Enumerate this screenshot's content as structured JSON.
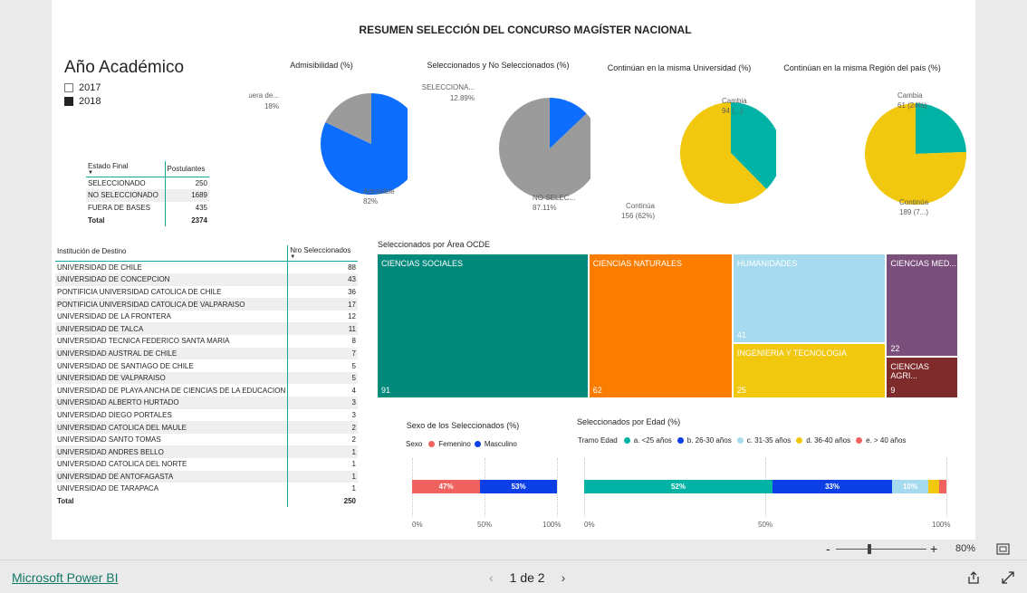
{
  "report": {
    "title": "RESUMEN SELECCIÓN DEL CONCURSO MAGÍSTER NACIONAL"
  },
  "slicer": {
    "title": "Año Académico",
    "options": [
      {
        "label": "2017",
        "checked": false
      },
      {
        "label": "2018",
        "checked": true
      }
    ]
  },
  "estado_table": {
    "headers": [
      "Estado Final",
      "Postulantes"
    ],
    "rows": [
      [
        "SELECCIONADO",
        "250"
      ],
      [
        "NO SELECCIONADO",
        "1689"
      ],
      [
        "FUERA DE BASES",
        "435"
      ]
    ],
    "total": [
      "Total",
      "2374"
    ]
  },
  "inst_table": {
    "headers": [
      "Institución de Destino",
      "Nro Seleccionados"
    ],
    "rows": [
      [
        "UNIVERSIDAD DE CHILE",
        "88"
      ],
      [
        "UNIVERSIDAD DE CONCEPCION",
        "43"
      ],
      [
        "PONTIFICIA UNIVERSIDAD CATOLICA DE CHILE",
        "36"
      ],
      [
        "PONTIFICIA UNIVERSIDAD CATOLICA DE VALPARAISO",
        "17"
      ],
      [
        "UNIVERSIDAD DE LA FRONTERA",
        "12"
      ],
      [
        "UNIVERSIDAD DE TALCA",
        "11"
      ],
      [
        "UNIVERSIDAD TECNICA FEDERICO SANTA MARIA",
        "8"
      ],
      [
        "UNIVERSIDAD AUSTRAL DE CHILE",
        "7"
      ],
      [
        "UNIVERSIDAD DE SANTIAGO DE CHILE",
        "5"
      ],
      [
        "UNIVERSIDAD DE VALPARAISO",
        "5"
      ],
      [
        "UNIVERSIDAD DE PLAYA ANCHA DE CIENCIAS DE LA EDUCACION",
        "4"
      ],
      [
        "UNIVERSIDAD ALBERTO HURTADO",
        "3"
      ],
      [
        "UNIVERSIDAD DIEGO PORTALES",
        "3"
      ],
      [
        "UNIVERSIDAD CATOLICA DEL MAULE",
        "2"
      ],
      [
        "UNIVERSIDAD SANTO TOMAS",
        "2"
      ],
      [
        "UNIVERSIDAD ANDRES BELLO",
        "1"
      ],
      [
        "UNIVERSIDAD CATOLICA DEL NORTE",
        "1"
      ],
      [
        "UNIVERSIDAD DE ANTOFAGASTA",
        "1"
      ],
      [
        "UNIVERSIDAD DE TARAPACA",
        "1"
      ]
    ],
    "total": [
      "Total",
      "250"
    ]
  },
  "chart_data": [
    {
      "id": "pie1",
      "type": "pie",
      "title": "Admisibilidad (%)",
      "slices": [
        {
          "label": "Admisible",
          "value": 82,
          "label_text": "Admisible",
          "value_text": "82%",
          "color": "#0d6efd"
        },
        {
          "label": "Fuera de...",
          "value": 18,
          "label_text": "Fuera de...",
          "value_text": "18%",
          "color": "#9b9b9b"
        }
      ]
    },
    {
      "id": "pie2",
      "type": "pie",
      "title": "Seleccionados y No Seleccionados (%)",
      "slices": [
        {
          "label": "NO SELEC...",
          "value": 87.11,
          "label_text": "NO SELEC...",
          "value_text": "87.11%",
          "color": "#9b9b9b"
        },
        {
          "label": "SELECCIONA...",
          "value": 12.89,
          "label_text": "SELECCIONA...",
          "value_text": "12.89%",
          "color": "#0d6efd"
        }
      ]
    },
    {
      "id": "pie3",
      "type": "pie",
      "title": "Continúan en la misma Universidad (%)",
      "slices": [
        {
          "label": "Cambia",
          "value": 94,
          "label_text": "Cambia",
          "value_text": "94 (...)",
          "color": "#00b3a4"
        },
        {
          "label": "Continúa",
          "value": 156,
          "label_text": "Continúa",
          "value_text": "156 (62%)",
          "color": "#f2c80f"
        }
      ]
    },
    {
      "id": "pie4",
      "type": "pie",
      "title": "Continúan en la misma Región del país (%)",
      "slices": [
        {
          "label": "Cambia",
          "value": 61,
          "label_text": "Cambia",
          "value_text": "61 (24%)",
          "color": "#00b3a4"
        },
        {
          "label": "Continúa",
          "value": 189,
          "label_text": "Continúa",
          "value_text": "189 (7...)",
          "color": "#f2c80f"
        }
      ]
    },
    {
      "id": "treemap",
      "type": "treemap",
      "title": "Seleccionados por Área OCDE",
      "items": [
        {
          "label": "CIENCIAS SOCIALES",
          "value": 91,
          "color": "#01897b"
        },
        {
          "label": "CIENCIAS NATURALES",
          "value": 62,
          "color": "#fb7d00"
        },
        {
          "label": "HUMANIDADES",
          "value": 41,
          "color": "#a6dbef"
        },
        {
          "label": "INGENIERIA Y TECNOLOGIA",
          "value": 25,
          "color": "#f2c80f"
        },
        {
          "label": "CIENCIAS MED...",
          "value": 22,
          "color": "#7a4f7c"
        },
        {
          "label": "CIENCIAS AGRI...",
          "value": 9,
          "color": "#7f2b2b"
        }
      ]
    },
    {
      "id": "sexo",
      "type": "bar",
      "stacked": "100%",
      "title": "Sexo de los Seleccionados (%)",
      "legend_title": "Sexo",
      "series": [
        {
          "name": "Femenino",
          "value": 47,
          "label": "47%",
          "color": "#f0625f"
        },
        {
          "name": "Masculino",
          "value": 53,
          "label": "53%",
          "color": "#0d3fe6"
        }
      ],
      "ticks": [
        "0%",
        "50%",
        "100%"
      ]
    },
    {
      "id": "edad",
      "type": "bar",
      "stacked": "100%",
      "title": "Seleccionados por Edad (%)",
      "legend_title": "Tramo Edad",
      "series": [
        {
          "name": "a. <25 años",
          "value": 52,
          "label": "52%",
          "color": "#00b3a4"
        },
        {
          "name": "b. 26-30 años",
          "value": 33,
          "label": "33%",
          "color": "#0d3fe6"
        },
        {
          "name": "c. 31-35 años",
          "value": 10,
          "label": "10%",
          "color": "#a6dbef"
        },
        {
          "name": "d. 36-40 años",
          "value": 3,
          "label": "",
          "color": "#f2c80f"
        },
        {
          "name": "e. > 40 años",
          "value": 2,
          "label": "",
          "color": "#f0625f"
        }
      ],
      "ticks": [
        "0%",
        "50%",
        "100%"
      ]
    }
  ],
  "footer": {
    "brand": "Microsoft Power BI",
    "page": "1 de 2",
    "zoom": "80%"
  }
}
